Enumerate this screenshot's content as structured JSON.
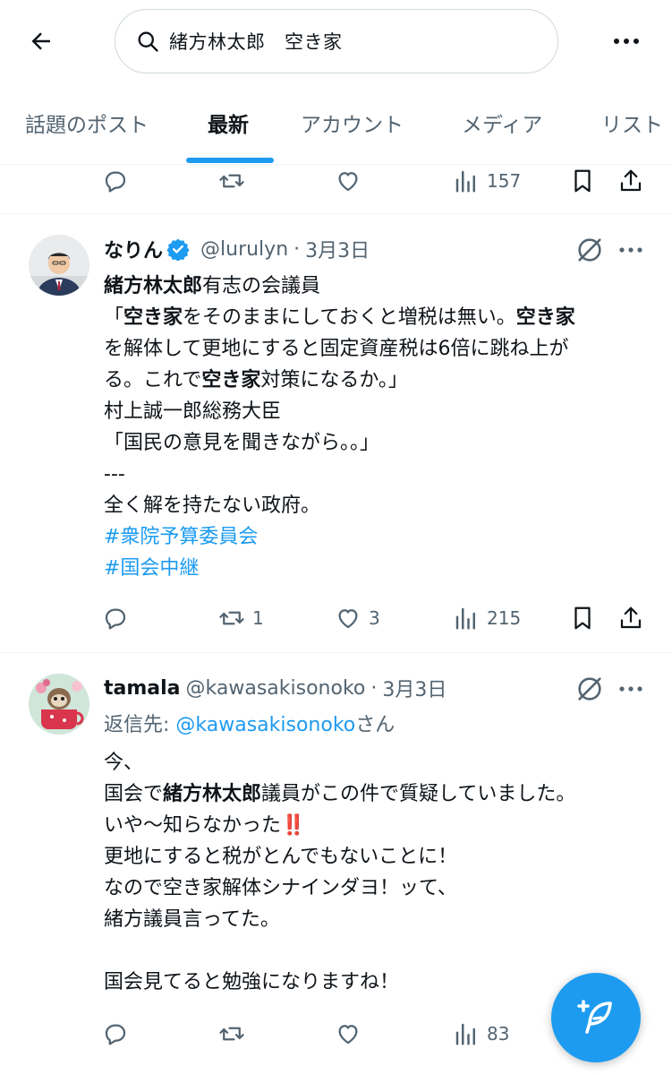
{
  "search": {
    "query": "緒方林太郎　空き家"
  },
  "tabs": [
    {
      "label": "話題のポスト"
    },
    {
      "label": "最新"
    },
    {
      "label": "アカウント"
    },
    {
      "label": "メディア"
    },
    {
      "label": "リスト"
    }
  ],
  "active_tab": "最新",
  "top_actions": {
    "views": "157"
  },
  "post1": {
    "name": "なりん",
    "handle": "@lurulyn",
    "separator": "·",
    "date": "3月3日",
    "lines": [
      [
        {
          "t": "緒方林太郎",
          "b": true
        },
        {
          "t": "有志の会議員"
        }
      ],
      [
        {
          "t": "「"
        },
        {
          "t": "空き家",
          "b": true
        },
        {
          "t": "をそのままにしておくと増税は無い。"
        },
        {
          "t": "空き家",
          "b": true
        }
      ],
      [
        {
          "t": "を解体して更地にすると固定資産税は6倍に跳ね上が"
        }
      ],
      [
        {
          "t": "る。これで"
        },
        {
          "t": "空き家",
          "b": true
        },
        {
          "t": "対策になるか。」"
        }
      ],
      [
        {
          "t": "村上誠一郎総務大臣"
        }
      ],
      [
        {
          "t": "「国民の意見を聞きながら。。」"
        }
      ],
      [
        {
          "t": "---"
        }
      ],
      [
        {
          "t": "全く解を持たない政府。"
        }
      ],
      [
        {
          "t": "#衆院予算委員会",
          "link": true
        }
      ],
      [
        {
          "t": "#国会中継",
          "link": true
        }
      ]
    ],
    "retweets": "1",
    "likes": "3",
    "views": "215"
  },
  "post2": {
    "name": "tamala",
    "handle": "@kawasakisonoko",
    "separator": "·",
    "date": "3月3日",
    "reply_prefix": "返信先: ",
    "reply_handle": "@kawasakisonoko",
    "reply_suffix": "さん",
    "lines": [
      [
        {
          "t": "今、"
        }
      ],
      [
        {
          "t": "国会で"
        },
        {
          "t": "緒方林太郎",
          "b": true
        },
        {
          "t": "議員がこの件で質疑していました。"
        }
      ],
      [
        {
          "t": "いや〜知らなかった"
        },
        {
          "t": "‼️",
          "emoji": true
        }
      ],
      [
        {
          "t": "更地にすると税がとんでもないことに！"
        }
      ],
      [
        {
          "t": "なので空き家解体シナインダヨ！ッて、"
        }
      ],
      [
        {
          "t": "緒方議員言ってた。"
        }
      ],
      [
        {
          "t": ""
        }
      ],
      [
        {
          "t": "国会見てると勉強になりますね！"
        }
      ]
    ],
    "views": "83"
  },
  "colors": {
    "accent": "#1d9bf0",
    "muted": "#536471",
    "text": "#0f1419",
    "divider": "#eff3f4"
  }
}
